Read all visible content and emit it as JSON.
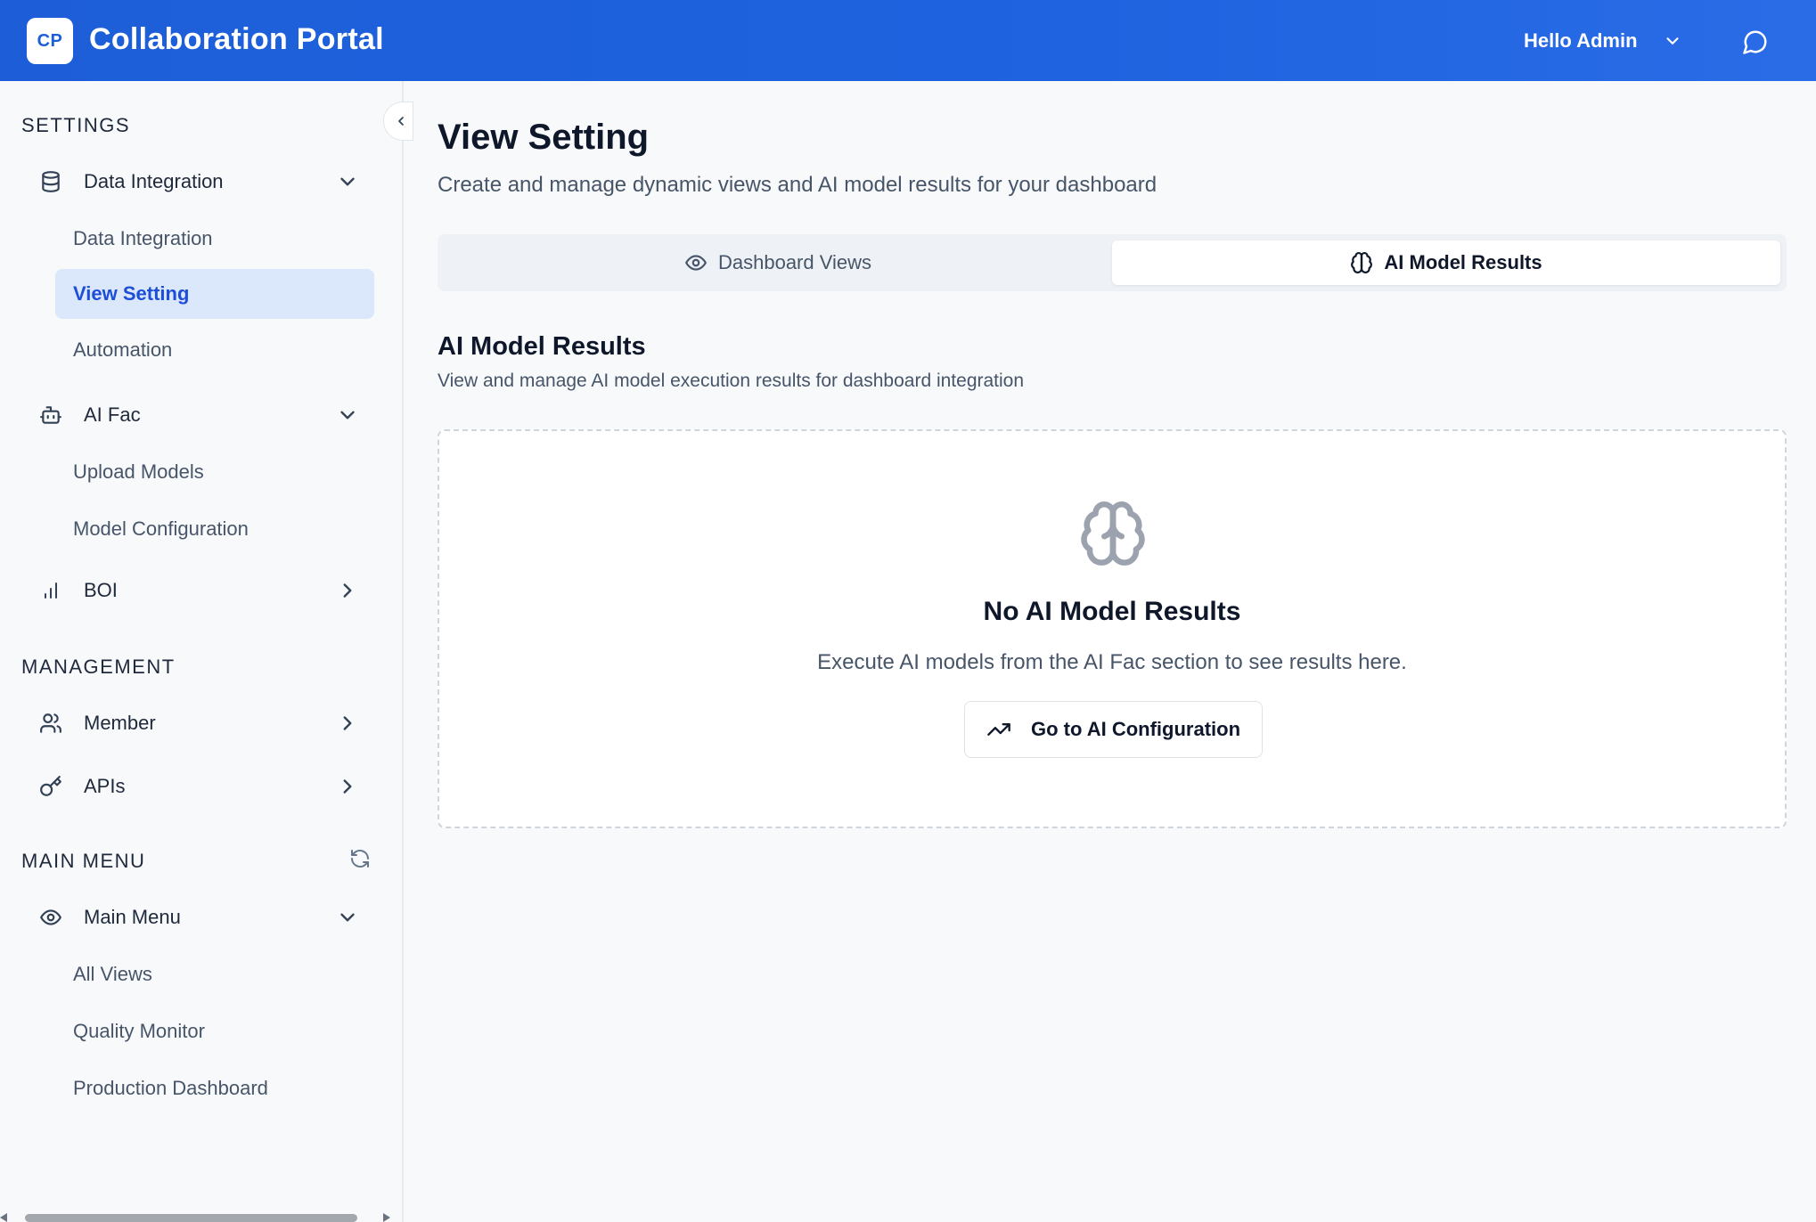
{
  "header": {
    "logo_text": "CP",
    "app_title": "Collaboration Portal",
    "user_greeting": "Hello Admin",
    "brand_color": "#1d5ed8"
  },
  "sidebar": {
    "sections": {
      "settings": "SETTINGS",
      "management": "MANAGEMENT",
      "main_menu": "MAIN MENU"
    },
    "groups": {
      "data_integration": {
        "label": "Data Integration",
        "icon": "database-icon",
        "expanded": true
      },
      "ai_fac": {
        "label": "AI Fac",
        "icon": "bot-icon",
        "expanded": true
      },
      "boi": {
        "label": "BOI",
        "icon": "bar-chart-icon",
        "expanded": false
      },
      "member": {
        "label": "Member",
        "icon": "users-icon",
        "expanded": false
      },
      "apis": {
        "label": "APIs",
        "icon": "key-icon",
        "expanded": false
      },
      "main_menu": {
        "label": "Main Menu",
        "icon": "eye-icon",
        "expanded": true
      }
    },
    "items": {
      "data_integration": "Data Integration",
      "view_setting": "View Setting",
      "automation": "Automation",
      "upload_models": "Upload Models",
      "model_configuration": "Model Configuration",
      "all_views": "All Views",
      "quality_monitor": "Quality Monitor",
      "production_dashboard": "Production Dashboard"
    },
    "active_item": "View Setting",
    "active_color": "#1d4ed8"
  },
  "main": {
    "title": "View Setting",
    "subtitle": "Create and manage dynamic views and AI model results for your dashboard",
    "tabs": [
      {
        "label": "Dashboard Views",
        "icon": "eye-icon",
        "selected": false
      },
      {
        "label": "AI Model Results",
        "icon": "brain-icon",
        "selected": true
      }
    ],
    "section_title": "AI Model Results",
    "section_subtitle": "View and manage AI model execution results for dashboard integration",
    "empty_state": {
      "icon": "brain-icon",
      "title": "No AI Model Results",
      "text": "Execute AI models from the AI Fac section to see results here.",
      "button_label": "Go to AI Configuration",
      "button_icon": "trending-up-icon"
    }
  }
}
